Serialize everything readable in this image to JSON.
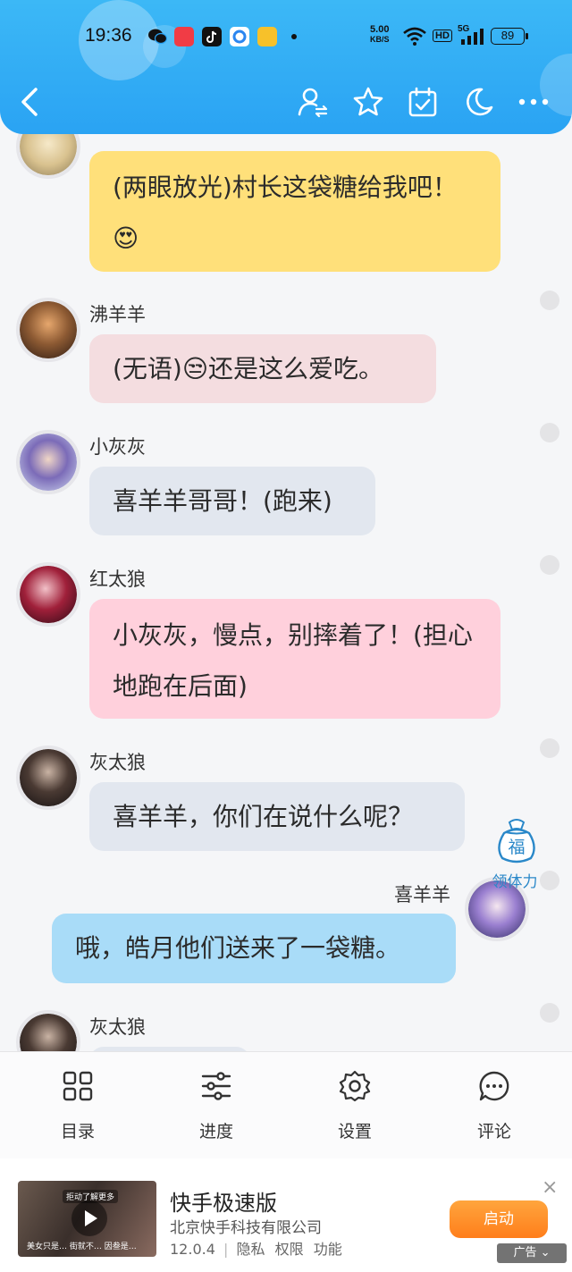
{
  "status_bar": {
    "time": "19:36",
    "net_speed_value": "5.00",
    "net_speed_unit": "KB/S",
    "hd_label": "HD",
    "network_label": "5G",
    "battery": "89"
  },
  "toolbar": {
    "icons": [
      "back-icon",
      "switch-user-icon",
      "star-icon",
      "calendar-check-icon",
      "moon-icon",
      "more-icon"
    ]
  },
  "messages": [
    {
      "name": "",
      "text": "(两眼放光)村长这袋糖给我吧！😍",
      "bubble_color": "#ffe07a"
    },
    {
      "name": "沸羊羊",
      "text": "(无语)😒还是这么爱吃。",
      "bubble_color": "#f4dde0"
    },
    {
      "name": "小灰灰",
      "text": "喜羊羊哥哥！(跑来)",
      "bubble_color": "#e2e7ef"
    },
    {
      "name": "红太狼",
      "text": "小灰灰，慢点，别摔着了！(担心地跑在后面)",
      "bubble_color": "#ffd0dc"
    },
    {
      "name": "灰太狼",
      "text": "喜羊羊，你们在说什么呢？",
      "bubble_color": "#e2e7ef"
    },
    {
      "name": "喜羊羊",
      "text": "哦，皓月他们送来了一袋糖。",
      "bubble_color": "#a9dcf8"
    },
    {
      "name": "灰太狼",
      "text": "",
      "bubble_color": "#e2e7ef"
    }
  ],
  "floating_widget": {
    "char": "福",
    "label": "领体力"
  },
  "bottom_nav": [
    {
      "icon": "grid-icon",
      "label": "目录"
    },
    {
      "icon": "sliders-icon",
      "label": "进度"
    },
    {
      "icon": "gear-icon",
      "label": "设置"
    },
    {
      "icon": "comment-icon",
      "label": "评论"
    }
  ],
  "ad": {
    "thumb_top": "拒动了解更多",
    "thumb_caption": "美女只是… 街就不… 因叁是…",
    "title": "快手极速版",
    "company": "北京快手科技有限公司",
    "version": "12.0.4",
    "links": [
      "隐私",
      "权限",
      "功能"
    ],
    "start_label": "启动",
    "close": "×",
    "tag": "广告 ⌄",
    "accent": "#ff8a22"
  },
  "colors": {
    "header": "#2fadf5",
    "background": "#f5f6f8"
  }
}
